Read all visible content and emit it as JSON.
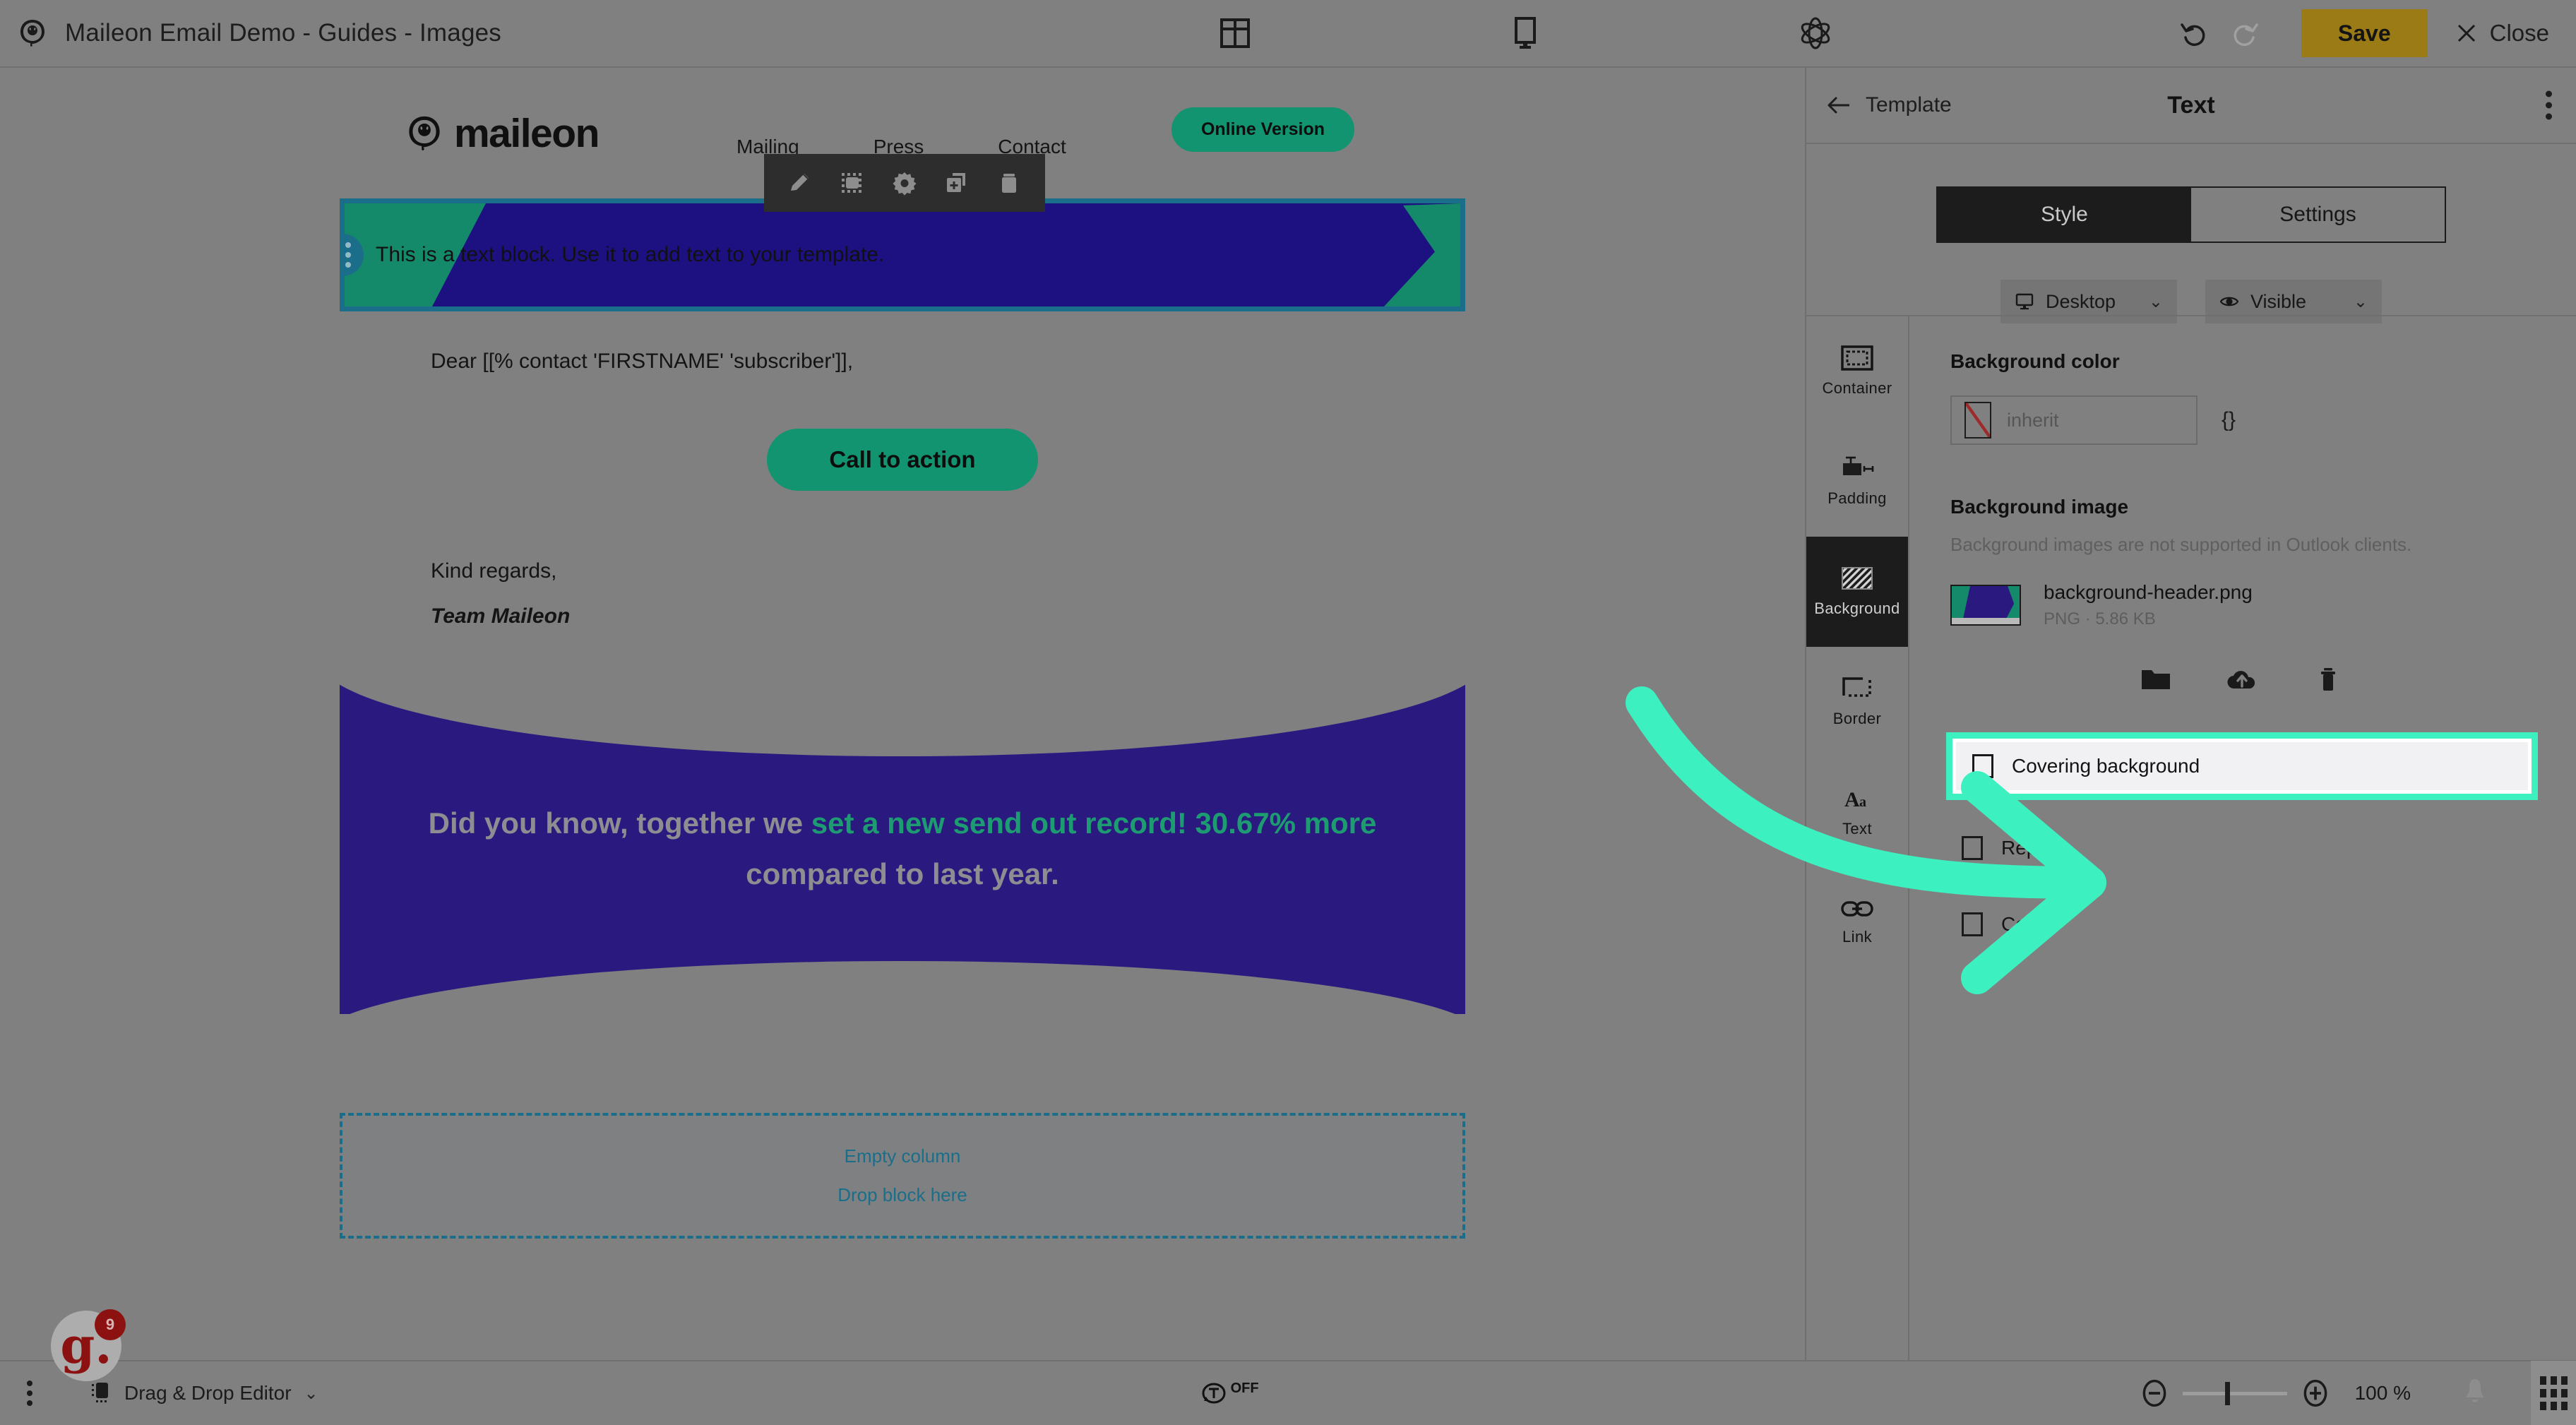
{
  "topbar": {
    "app_icon": "maileon-logo-icon",
    "document_title": "Maileon Email Demo - Guides - Images",
    "center_icons": [
      {
        "name": "layout-columns-icon"
      },
      {
        "name": "desktop-preview-icon"
      },
      {
        "name": "settings-atom-icon"
      }
    ],
    "undo_label": "undo-icon",
    "redo_label": "redo-icon",
    "save_label": "Save",
    "close_label": "Close"
  },
  "email": {
    "brand_name": "maileon",
    "nav": [
      "Mailing",
      "Press",
      "Contact"
    ],
    "online_version_label": "Online Version",
    "text_block": "This is a text block. Use it to add text to your template.",
    "salutation": "Dear [[% contact 'FIRSTNAME' 'subscriber']],",
    "cta_label": "Call to action",
    "regards": "Kind regards,",
    "signature": "Team Maileon",
    "hero": {
      "part1": "Did you know, together we ",
      "part2": "set a new send out record! 30.67% more",
      "part3": " compared to last year."
    },
    "empty_column_title": "Empty column",
    "empty_column_sub": "Drop block here"
  },
  "block_toolbar": {
    "items": [
      {
        "name": "edit-pencil-icon",
        "label": "Edit"
      },
      {
        "name": "select-block-icon",
        "label": "Select"
      },
      {
        "name": "gear-icon",
        "label": "Settings"
      },
      {
        "name": "duplicate-icon",
        "label": "Duplicate"
      },
      {
        "name": "trash-icon",
        "label": "Delete"
      }
    ]
  },
  "panel": {
    "back_label": "Template",
    "title": "Text",
    "kebab": "more-options-icon",
    "tabs": [
      {
        "label": "Style",
        "active": true
      },
      {
        "label": "Settings",
        "active": false
      }
    ],
    "device_select": {
      "label": "Desktop",
      "icon": "monitor-icon"
    },
    "visibility_select": {
      "label": "Visible",
      "icon": "eye-icon"
    },
    "tools": [
      {
        "label": "Container",
        "icon": "container-icon",
        "active": false
      },
      {
        "label": "Padding",
        "icon": "padding-icon",
        "active": false
      },
      {
        "label": "Background",
        "icon": "background-hatch-icon",
        "active": true
      },
      {
        "label": "Border",
        "icon": "border-icon",
        "active": false
      },
      {
        "label": "Text",
        "icon": "text-icon",
        "active": false
      },
      {
        "label": "Link",
        "icon": "link-icon",
        "active": false
      }
    ],
    "background_color": {
      "section_title": "Background color",
      "value": "inherit",
      "code_toggle": "{}"
    },
    "background_image": {
      "section_title": "Background image",
      "hint": "Background images are not supported in Outlook clients.",
      "file_name": "background-header.png",
      "file_meta": "PNG · 5.86 KB",
      "actions": [
        {
          "name": "folder-browse-icon"
        },
        {
          "name": "cloud-upload-icon"
        },
        {
          "name": "trash-icon"
        }
      ]
    },
    "options": [
      {
        "label": "Covering background",
        "checked": false,
        "highlighted": true
      },
      {
        "label": "Repeat",
        "checked": false,
        "highlighted": false
      },
      {
        "label": "Center",
        "checked": false,
        "highlighted": false
      }
    ]
  },
  "bottombar": {
    "kebab": "more-options-icon",
    "editor_mode": "Drag & Drop Editor",
    "toggle_state": "OFF",
    "zoom_value": "100 %",
    "bell": "notifications-icon",
    "grid": "apps-grid-icon"
  },
  "chat_widget": {
    "logo": "g.",
    "badge_count": "9"
  },
  "colors": {
    "accent_teal": "#3df0c0",
    "brand_green": "#11946f",
    "brand_purple": "#2a1a80",
    "save_gold": "#9a7b16",
    "panel_bg": "#808080",
    "selection_blue": "#1b6e8a"
  }
}
